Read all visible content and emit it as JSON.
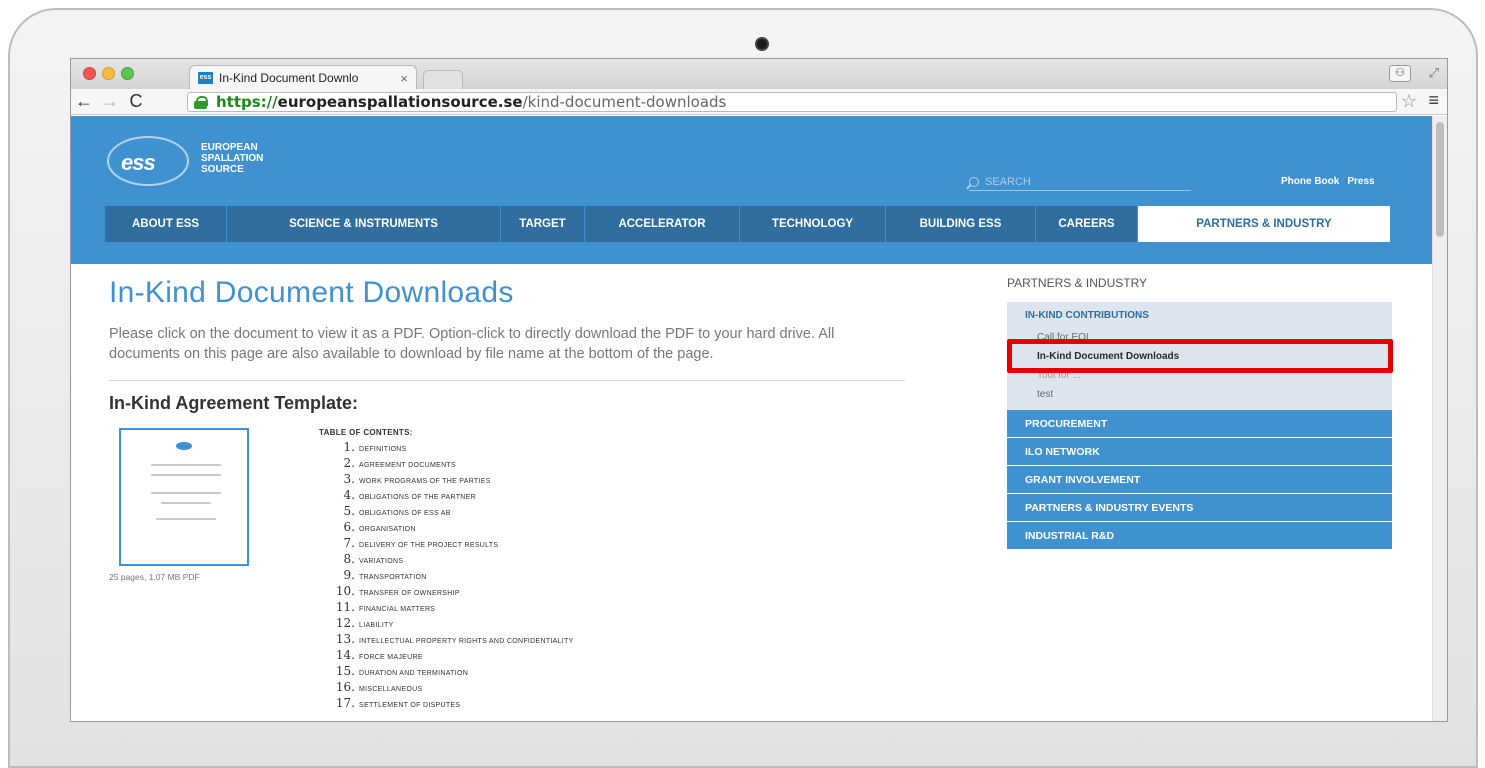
{
  "browser": {
    "tab_title": "In-Kind Document Downlo",
    "tab_close": "×",
    "url_scheme": "https://",
    "url_host": "europeanspallationsource.se",
    "url_path": "/kind-document-downloads",
    "back": "←",
    "forward": "→",
    "reload": "C",
    "star": "☆",
    "menu": "≡",
    "user": "⚇",
    "resize": "⤢"
  },
  "site": {
    "logo_mark": "ess",
    "logo_lines": [
      "EUROPEAN",
      "SPALLATION",
      "SOURCE"
    ],
    "search_placeholder": "SEARCH",
    "utility_links": [
      "Phone Book",
      "Press"
    ],
    "nav": [
      "ABOUT ESS",
      "SCIENCE & INSTRUMENTS",
      "TARGET",
      "ACCELERATOR",
      "TECHNOLOGY",
      "BUILDING ESS",
      "CAREERS",
      "PARTNERS & INDUSTRY"
    ],
    "nav_active": "PARTNERS & INDUSTRY"
  },
  "main": {
    "title": "In-Kind Document Downloads",
    "intro": "Please click on the document to view it as a PDF. Option-click to directly download the PDF to your hard drive. All documents on this page are also available to download by file name at the bottom of the page.",
    "section_title": "In-Kind Agreement Template:",
    "doc_caption": "25 pages, 1.07 MB PDF",
    "toc_heading": "TABLE OF CONTENTS:",
    "toc": [
      {
        "num": "1.",
        "label": "DEFINITIONS"
      },
      {
        "num": "2.",
        "label": "AGREEMENT DOCUMENTS"
      },
      {
        "num": "3.",
        "label": "WORK PROGRAMS OF THE PARTIES"
      },
      {
        "num": "4.",
        "label": "OBLIGATIONS OF THE PARTNER"
      },
      {
        "num": "5.",
        "label": "OBLIGATIONS OF ESS AB"
      },
      {
        "num": "6.",
        "label": "ORGANISATION"
      },
      {
        "num": "7.",
        "label": "DELIVERY OF THE PROJECT RESULTS"
      },
      {
        "num": "8.",
        "label": "VARIATIONS"
      },
      {
        "num": "9.",
        "label": "TRANSPORTATION"
      },
      {
        "num": "10.",
        "label": "TRANSFER OF OWNERSHIP"
      },
      {
        "num": "11.",
        "label": "FINANCIAL MATTERS"
      },
      {
        "num": "12.",
        "label": "LIABILITY"
      },
      {
        "num": "13.",
        "label": "INTELLECTUAL PROPERTY RIGHTS AND CONFIDENTIALITY"
      },
      {
        "num": "14.",
        "label": "FORCE MAJEURE"
      },
      {
        "num": "15.",
        "label": "DURATION AND TERMINATION"
      },
      {
        "num": "16.",
        "label": "MISCELLANEOUS"
      },
      {
        "num": "17.",
        "label": "SETTLEMENT OF DISPUTES"
      }
    ]
  },
  "sidebar": {
    "heading": "PARTNERS & INDUSTRY",
    "group_title": "IN-KIND CONTRIBUTIONS",
    "sub_items": [
      "Call for EOI",
      "In-Kind Document Downloads",
      "Tool for ...",
      "test"
    ],
    "items": [
      "PROCUREMENT",
      "ILO NETWORK",
      "GRANT INVOLVEMENT",
      "PARTNERS & INDUSTRY EVENTS",
      "INDUSTRIAL R&D"
    ]
  },
  "colors": {
    "brand_blue": "#3f91cf",
    "nav_dark": "#2f6e9e",
    "highlight_red": "#e60000"
  }
}
